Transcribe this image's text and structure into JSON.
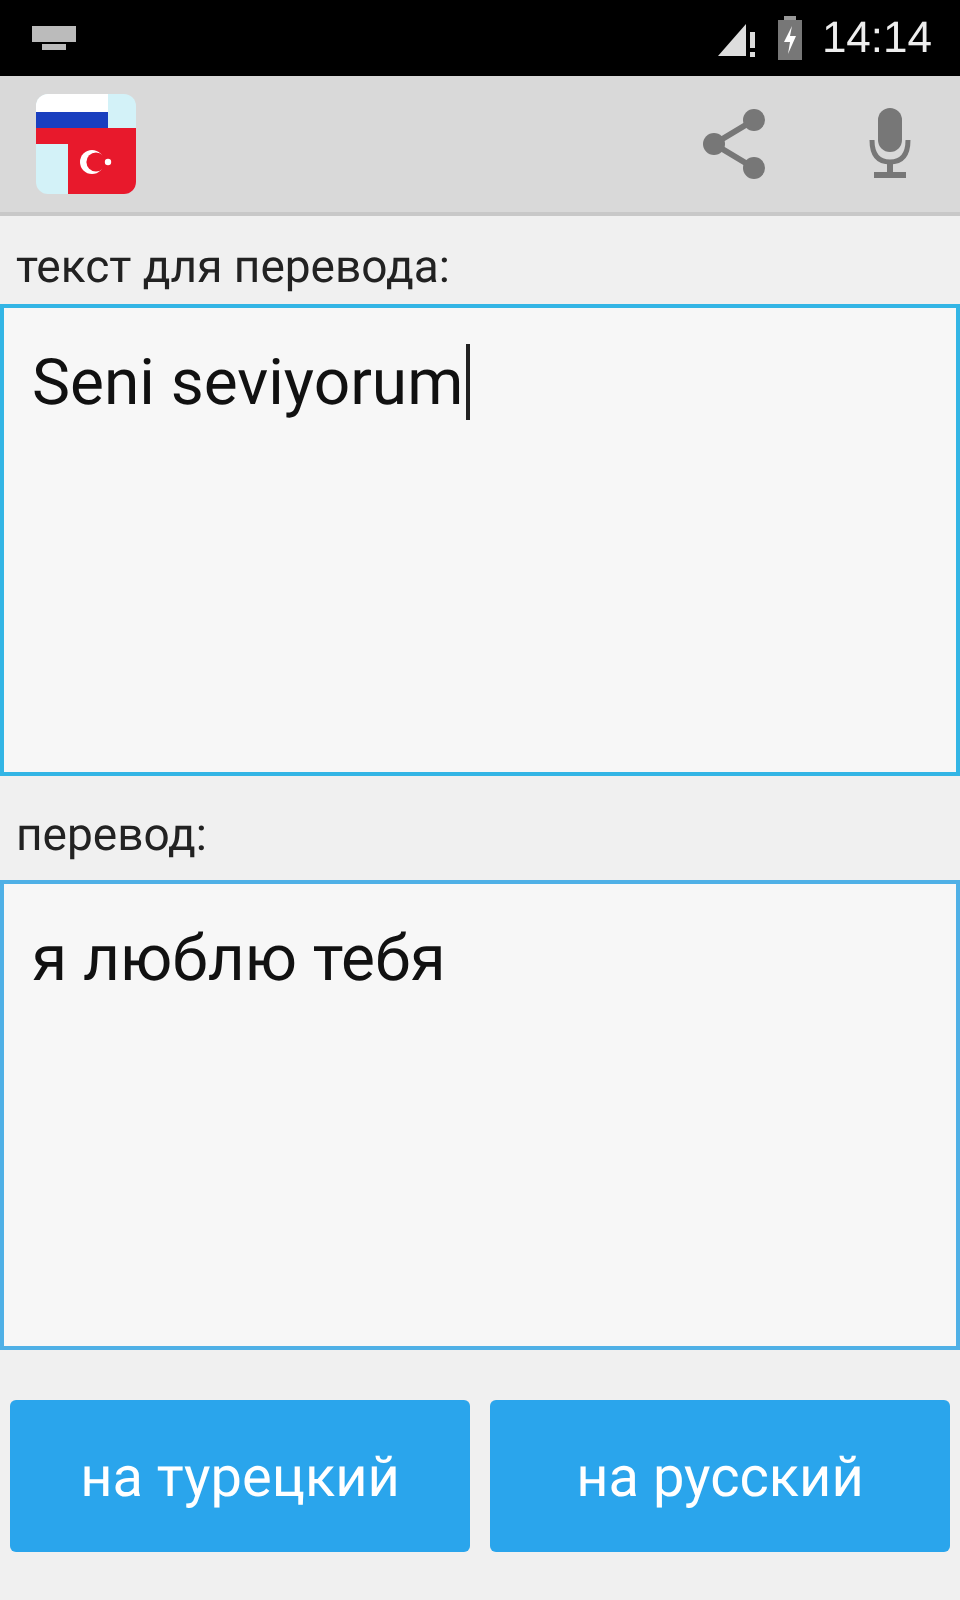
{
  "status_bar": {
    "time": "14:14"
  },
  "source": {
    "label": "текст для перевода:",
    "value": "Seni seviyorum",
    "focused": true
  },
  "result": {
    "label": "перевод:",
    "text": "я люблю тебя"
  },
  "buttons": [
    {
      "label": "на турецкий"
    },
    {
      "label": "на русский"
    }
  ]
}
